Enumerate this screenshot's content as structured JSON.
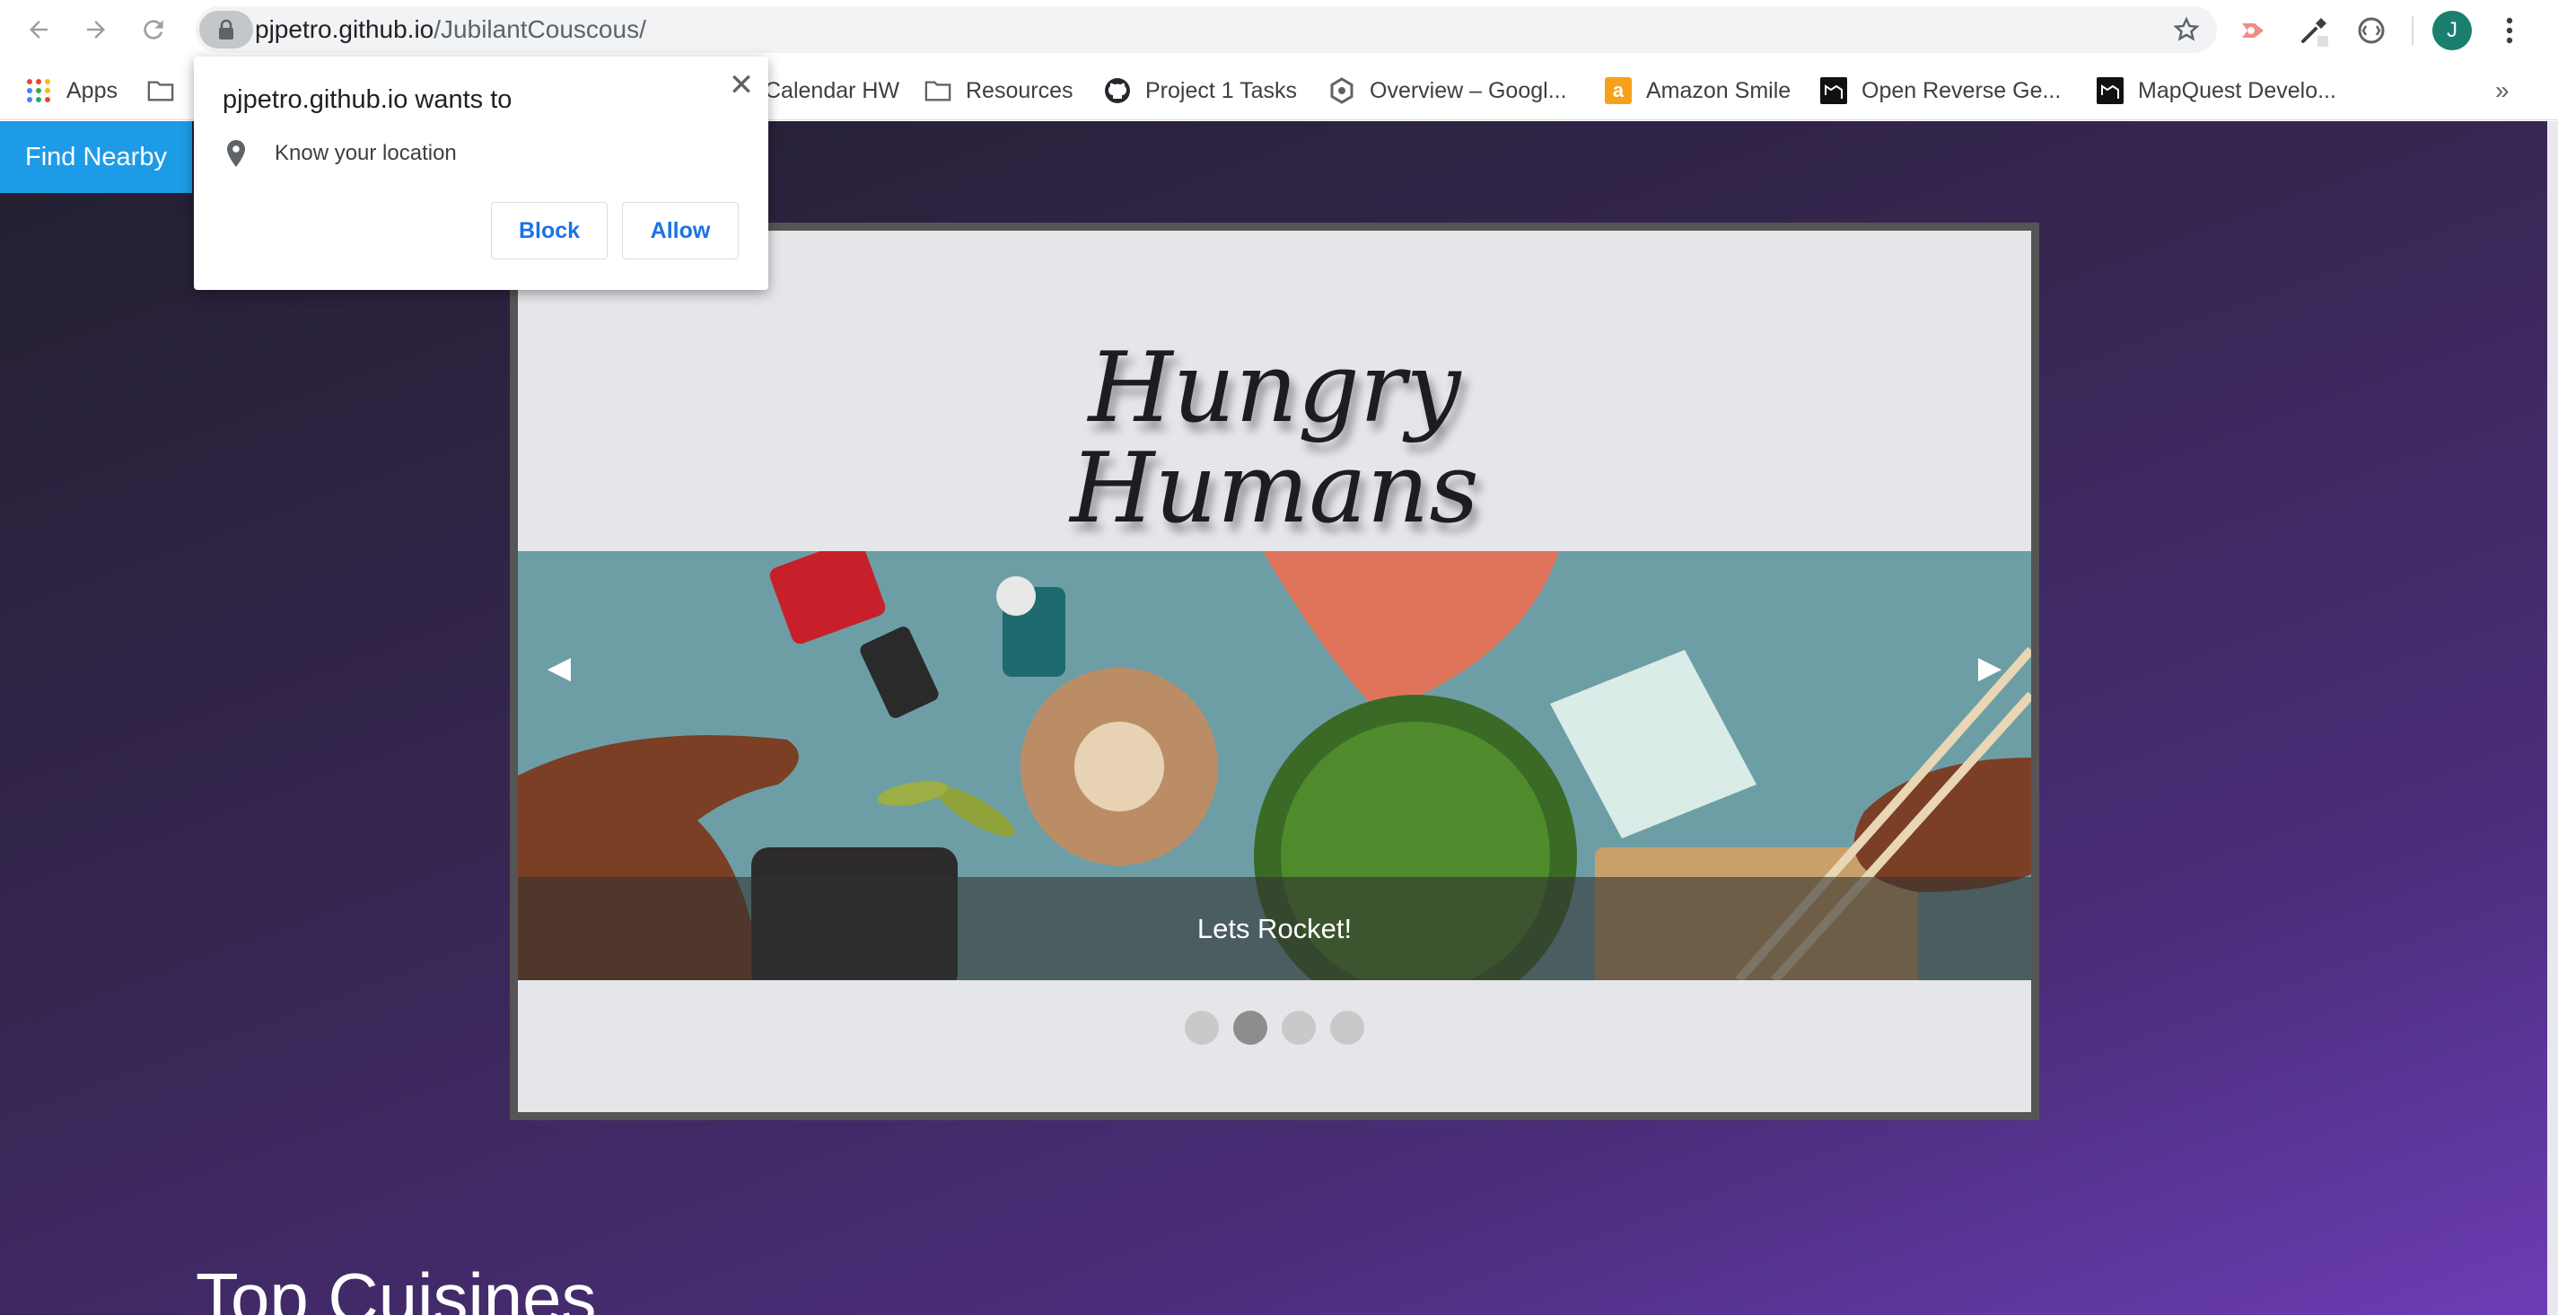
{
  "browser": {
    "url_host": "pjpetro.github.io",
    "url_path": "/JubilantCouscous/",
    "avatar_letter": "J",
    "icons": [
      "back-icon",
      "forward-icon",
      "reload-icon",
      "lock-icon",
      "star-icon",
      "extension-icon",
      "eyedropper-icon",
      "circle-extension-icon",
      "menu-dots-icon"
    ]
  },
  "bookmarks": {
    "items": [
      {
        "label": "Apps",
        "icon": "apps-icon"
      },
      {
        "label": "",
        "icon": "folder-icon"
      },
      {
        "label": "Calendar HW",
        "icon": "folder-icon"
      },
      {
        "label": "Resources",
        "icon": "folder-icon"
      },
      {
        "label": "Project 1 Tasks",
        "icon": "github-icon"
      },
      {
        "label": "Overview – Googl...",
        "icon": "google-cloud-icon"
      },
      {
        "label": "Amazon Smile",
        "icon": "amazon-icon"
      },
      {
        "label": "Open Reverse Ge...",
        "icon": "map-icon"
      },
      {
        "label": "MapQuest Develo...",
        "icon": "map-icon"
      }
    ],
    "more": "»"
  },
  "popup": {
    "title": "pjpetro.github.io wants to",
    "permission": "Know your location",
    "block_label": "Block",
    "allow_label": "Allow",
    "close": "✕"
  },
  "page": {
    "nav_button": "Find Nearby",
    "hero_line1": "Hungry",
    "hero_line2": "Humans",
    "slide_caption": "Lets Rocket!",
    "prev_arrow": "◀",
    "next_arrow": "▶",
    "slide_count": 4,
    "active_slide": 2,
    "section_heading": "Top Cuisines"
  },
  "colors": {
    "accent_button": "#1e9be6",
    "link_blue": "#1a73e8",
    "frame_border": "#555555"
  }
}
